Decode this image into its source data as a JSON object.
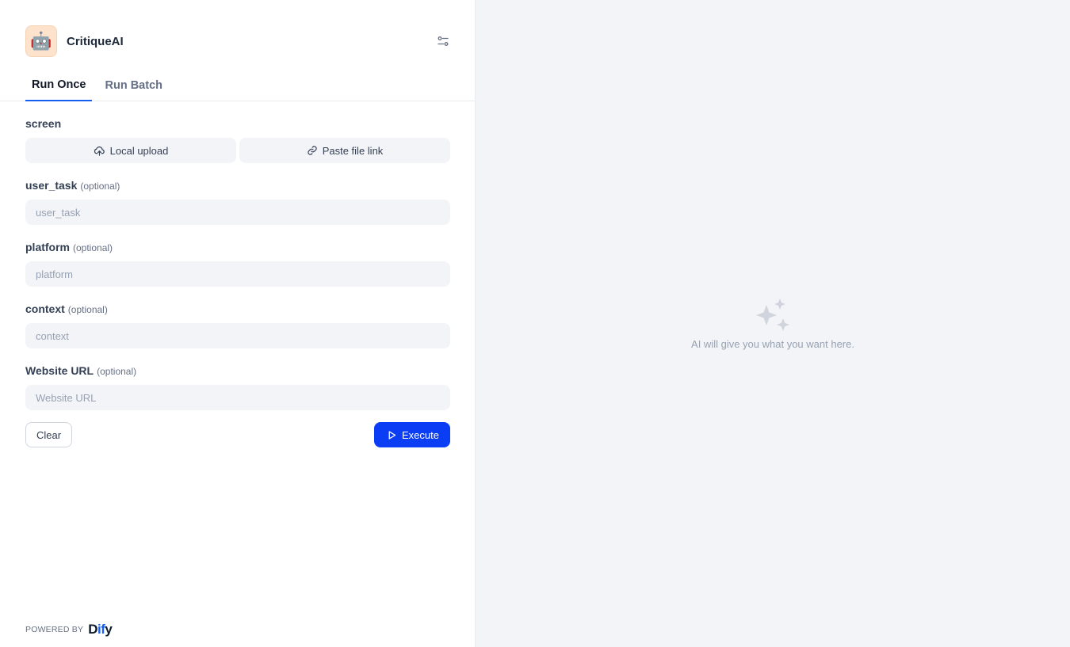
{
  "app": {
    "name": "CritiqueAI",
    "icon": "robot-emoji",
    "icon_glyph": "🤖"
  },
  "tabs": [
    {
      "label": "Run Once",
      "active": true
    },
    {
      "label": "Run Batch",
      "active": false
    }
  ],
  "form": {
    "screen": {
      "label": "screen",
      "local_upload": "Local upload",
      "paste_link": "Paste file link"
    },
    "fields": [
      {
        "label": "user_task",
        "optional": "(optional)",
        "placeholder": "user_task",
        "value": ""
      },
      {
        "label": "platform",
        "optional": "(optional)",
        "placeholder": "platform",
        "value": ""
      },
      {
        "label": "context",
        "optional": "(optional)",
        "placeholder": "context",
        "value": ""
      },
      {
        "label": "Website URL",
        "optional": "(optional)",
        "placeholder": "Website URL",
        "value": ""
      }
    ]
  },
  "actions": {
    "clear": "Clear",
    "execute": "Execute"
  },
  "footer": {
    "powered_by": "POWERED BY",
    "brand_d": "D",
    "brand_if": "if",
    "brand_y": "y"
  },
  "result": {
    "empty_text": "AI will give you what you want here.",
    "icon": "sparkles-icon"
  },
  "colors": {
    "accent": "#155eef",
    "execute_bg": "#0b3df5",
    "panel_bg": "#f2f4f7"
  }
}
